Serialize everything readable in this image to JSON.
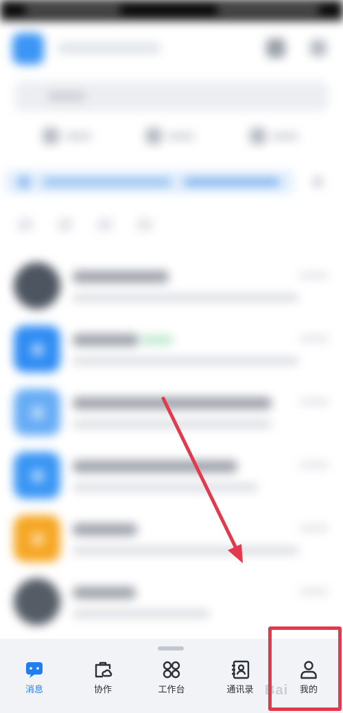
{
  "tabbar": {
    "tabs": [
      {
        "id": "messages",
        "label": "消息",
        "icon": "chat-bubble-icon",
        "active": true
      },
      {
        "id": "collab",
        "label": "协作",
        "icon": "briefcase-cloud-icon",
        "active": false
      },
      {
        "id": "workbench",
        "label": "工作台",
        "icon": "app-grid-icon",
        "active": false
      },
      {
        "id": "contacts",
        "label": "通讯录",
        "icon": "contact-book-icon",
        "active": false
      },
      {
        "id": "me",
        "label": "我的",
        "icon": "person-icon",
        "active": false
      }
    ]
  },
  "watermark": {
    "text": "Bai"
  },
  "annotation": {
    "highlight_target": "me",
    "color": "#e23a4c"
  },
  "colors": {
    "accent": "#1f7ff0",
    "tabbar_bg": "#f1f3f7",
    "annotation": "#e23a4c"
  }
}
